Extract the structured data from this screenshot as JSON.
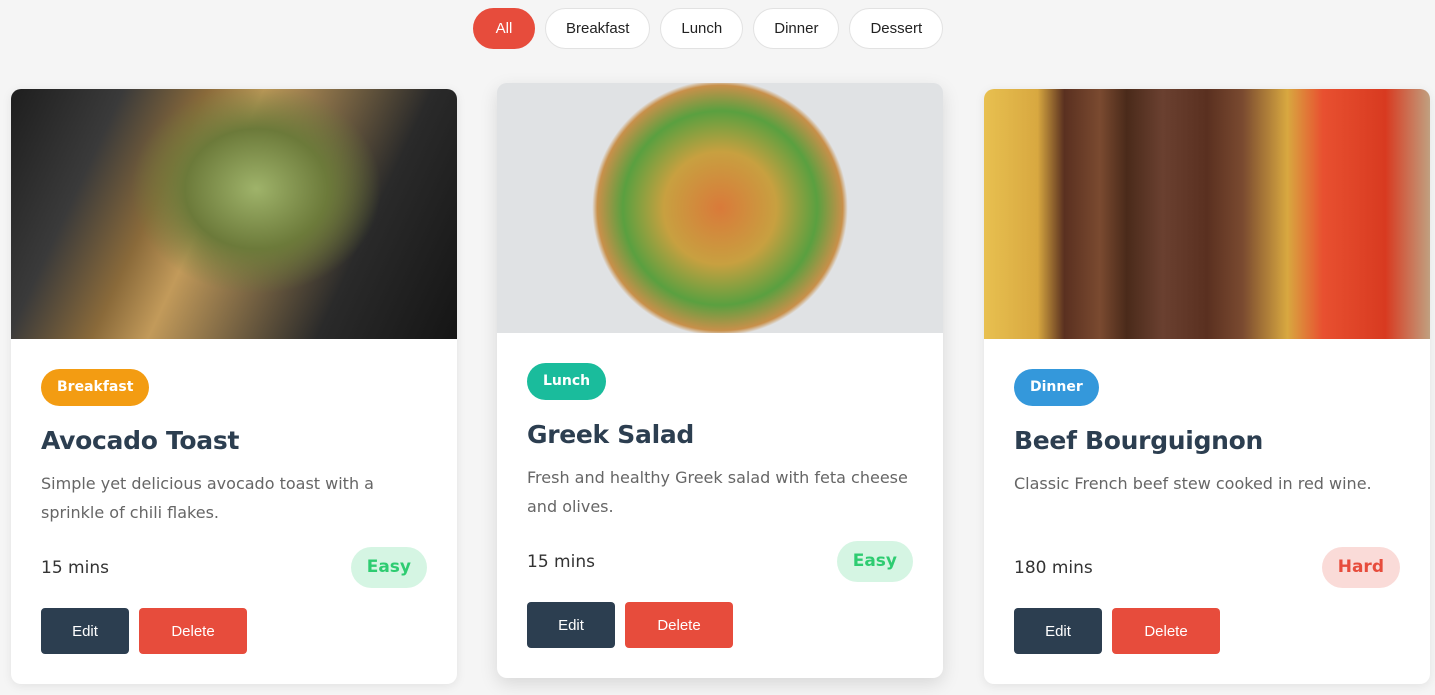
{
  "filters": [
    {
      "label": "All",
      "active": true
    },
    {
      "label": "Breakfast"
    },
    {
      "label": "Lunch"
    },
    {
      "label": "Dinner"
    },
    {
      "label": "Dessert"
    }
  ],
  "recipes": [
    {
      "category": "Breakfast",
      "category_color": "#f39c12",
      "title": "Avocado Toast",
      "description": "Simple yet delicious avocado toast with a sprinkle of chili flakes.",
      "time": "15 mins",
      "difficulty": "Easy",
      "edit": "Edit",
      "delete": "Delete"
    },
    {
      "category": "Lunch",
      "category_color": "#1abc9c",
      "title": "Greek Salad",
      "description": "Fresh and healthy Greek salad with feta cheese and olives.",
      "time": "15 mins",
      "difficulty": "Easy",
      "edit": "Edit",
      "delete": "Delete"
    },
    {
      "category": "Dinner",
      "category_color": "#3498db",
      "title": "Beef Bourguignon",
      "description": "Classic French beef stew cooked in red wine.",
      "time": "180 mins",
      "difficulty": "Hard",
      "edit": "Edit",
      "delete": "Delete"
    }
  ]
}
